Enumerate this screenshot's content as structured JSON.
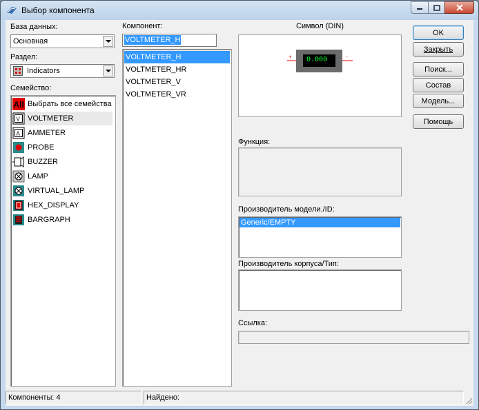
{
  "window": {
    "title": "Выбор компонента"
  },
  "database": {
    "label": "База данных:",
    "value": "Основная"
  },
  "group": {
    "label": "Раздел:",
    "value": "Indicators"
  },
  "family": {
    "label": "Семейство:",
    "items": [
      {
        "label": "Выбрать все семейства",
        "icon": "all-families-icon"
      },
      {
        "label": "VOLTMETER",
        "icon": "voltmeter-icon"
      },
      {
        "label": "AMMETER",
        "icon": "ammeter-icon"
      },
      {
        "label": "PROBE",
        "icon": "probe-icon"
      },
      {
        "label": "BUZZER",
        "icon": "buzzer-icon"
      },
      {
        "label": "LAMP",
        "icon": "lamp-icon"
      },
      {
        "label": "VIRTUAL_LAMP",
        "icon": "virtual-lamp-icon"
      },
      {
        "label": "HEX_DISPLAY",
        "icon": "hex-display-icon"
      },
      {
        "label": "BARGRAPH",
        "icon": "bargraph-icon"
      }
    ]
  },
  "component": {
    "label": "Компонент:",
    "search_value": "VOLTMETER_H",
    "items": [
      "VOLTMETER_H",
      "VOLTMETER_HR",
      "VOLTMETER_V",
      "VOLTMETER_VR"
    ]
  },
  "symbol": {
    "label": "Символ (DIN)",
    "display": "0.000",
    "plus": "+",
    "minus": "-"
  },
  "function": {
    "label": "Функция:"
  },
  "model_manufacturer": {
    "label": "Производитель модели./ID:",
    "items": [
      "Generic/EMPTY"
    ]
  },
  "package_manufacturer": {
    "label": "Производитель корпуса/Тип:"
  },
  "link": {
    "label": "Ссылка:"
  },
  "buttons": {
    "ok": "OK",
    "close": "Закрыть",
    "search": "Поиск...",
    "detail": "Состав",
    "model": "Модель...",
    "help": "Помощь"
  },
  "status": {
    "components": "Компоненты: 4",
    "found": "Найдено:"
  },
  "colors": {
    "selection": "#3399ff",
    "window_frame": "#c6d9ee",
    "close_button": "#c94a32",
    "meter_body": "#6b6b6b",
    "meter_display": "#000000",
    "meter_digits": "#00ff33"
  }
}
